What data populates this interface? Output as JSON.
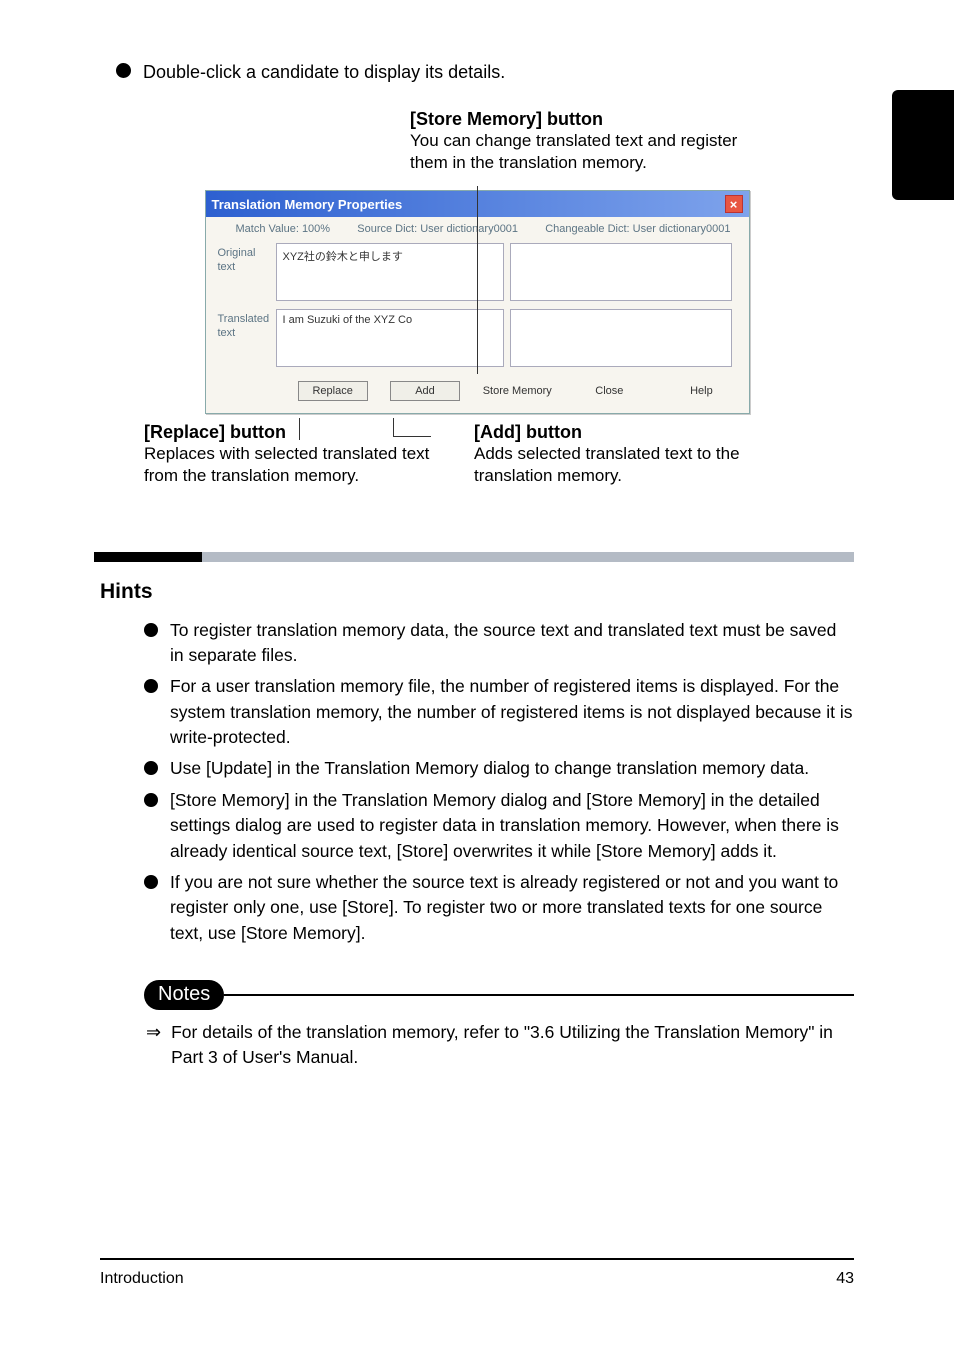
{
  "top_bullet": "Double-click a candidate to display its details.",
  "callout_store": {
    "title": "[Store Memory] button",
    "desc": "You can change translated text and register them in the translation memory."
  },
  "dialog": {
    "title": "Translation Memory Properties",
    "close_glyph": "×",
    "match_label": "Match Value: 100%",
    "source_label": "Source Dict: User dictionary0001",
    "change_label": "Changeable Dict: User dictionary0001",
    "orig_label": "Original\ntext",
    "trans_label": "Translated\ntext",
    "orig_value": "XYZ社の鈴木と申します",
    "trans_value": "I am Suzuki of the XYZ Co",
    "buttons": {
      "replace": "Replace",
      "add": "Add",
      "store": "Store Memory",
      "close": "Close",
      "help": "Help"
    }
  },
  "callout_replace": {
    "title": "[Replace] button",
    "desc": "Replaces with selected translated text from the translation memory."
  },
  "callout_add": {
    "title": "[Add] button",
    "desc": "Adds selected translated text to the translation memory."
  },
  "hints_title": "Hints",
  "hints": [
    "To register translation memory data, the source text and translated text must be saved in separate files.",
    "For a user translation memory file, the number of registered items is displayed. For the system translation memory, the number of registered items is not displayed because it is write-protected.",
    "Use [Update] in the Translation Memory dialog to change translation memory data.",
    "[Store Memory] in the Translation Memory dialog and [Store Memory] in the detailed settings dialog are used to register data in translation memory. However, when there is already identical source text, [Store] overwrites it while [Store Memory] adds it.",
    "If you are not sure whether the source text is already registered or not and you want to register only one, use [Store]. To register two or more translated texts for one source text, use [Store Memory]."
  ],
  "notes": "For details of the translation memory, refer to \"3.6 Utilizing the Translation Memory\" in Part 3 of User's Manual.",
  "footer": {
    "left": "Introduction",
    "right": "43"
  }
}
